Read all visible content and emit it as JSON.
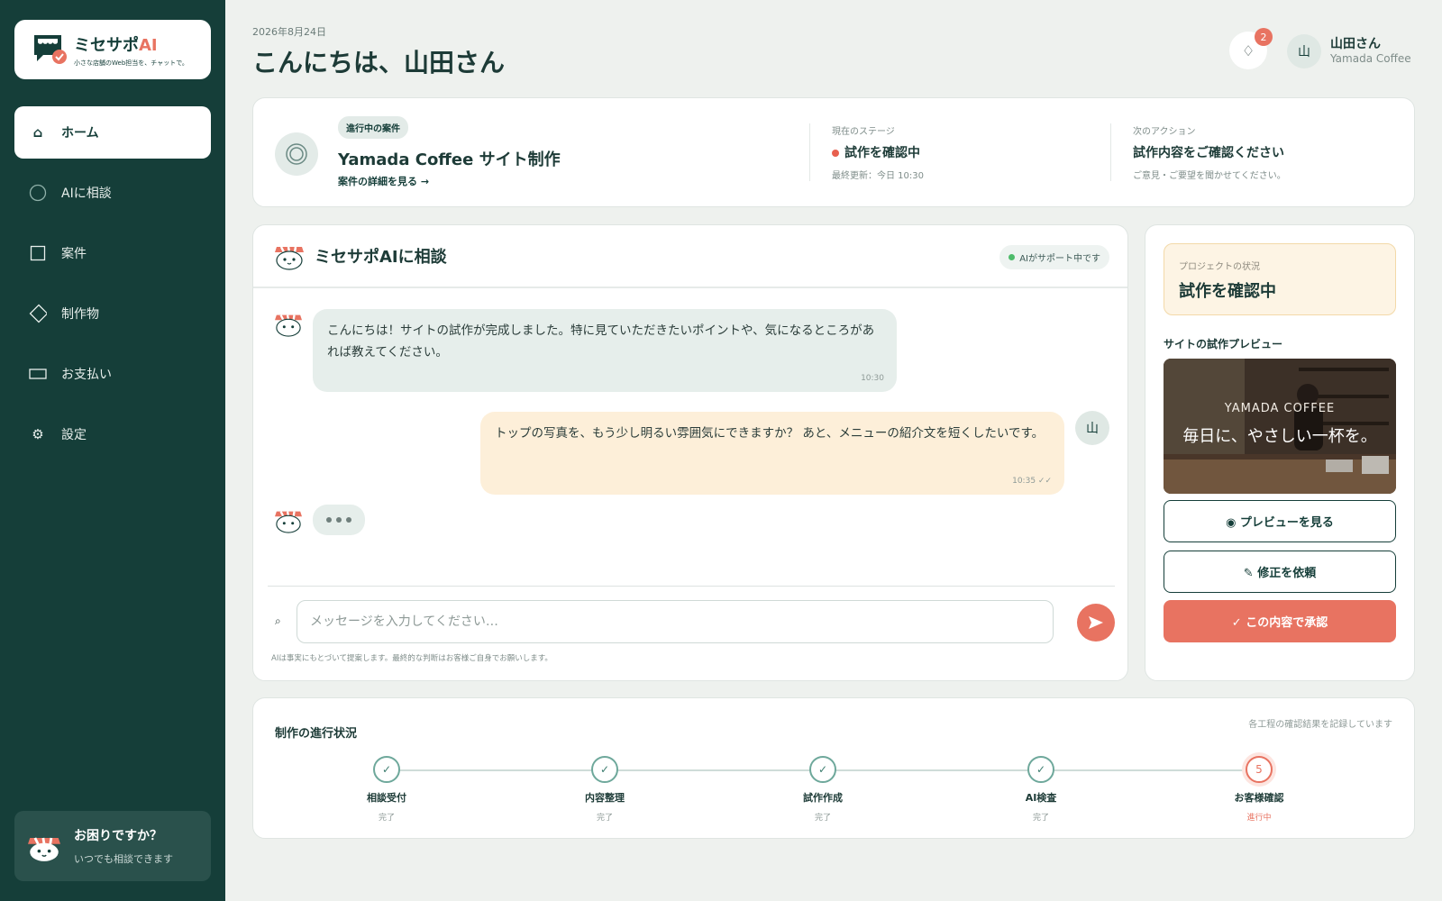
{
  "app": {
    "name_part1": "ミセサポ",
    "name_part2": "AI",
    "tagline": "小さな店舗のWeb担当を、チャットで。"
  },
  "sidebar": {
    "items": [
      {
        "label": "ホーム",
        "icon": "home-icon"
      },
      {
        "label": "AIに相談",
        "icon": "chat-circle-icon"
      },
      {
        "label": "案件",
        "icon": "square-icon"
      },
      {
        "label": "制作物",
        "icon": "diamond-icon"
      },
      {
        "label": "お支払い",
        "icon": "card-icon"
      },
      {
        "label": "設定",
        "icon": "gear-icon"
      }
    ],
    "help": {
      "title": "お困りですか？",
      "subtitle": "いつでも相談できます"
    }
  },
  "header": {
    "date": "2026年8月24日",
    "greeting": "こんにちは、山田さん",
    "notifications": "2",
    "user": {
      "initial": "山",
      "name": "山田さん",
      "shop": "Yamada Coffee"
    }
  },
  "project": {
    "badge": "進行中の案件",
    "title": "Yamada Coffee サイト制作",
    "link": "案件の詳細を見る →",
    "stage_label": "現在のステージ",
    "stage_value": "試作を確認中",
    "stage_updated": "最終更新：今日 10:30",
    "action_label": "次のアクション",
    "action_value": "試作内容をご確認ください",
    "action_sub": "ご意見・ご要望を聞かせてください。"
  },
  "chat": {
    "title": "ミセサポAIに相談",
    "status": "AIがサポート中です",
    "messages": [
      {
        "from": "ai",
        "text": "こんにちは！サイトの試作が完成しました。特に見ていただきたいポイントや、気になるところがあれば教えてください。",
        "time": "10:30"
      },
      {
        "from": "user",
        "text": "トップの写真を、もう少し明るい雰囲気にできますか？ あと、メニューの紹介文を短くしたいです。",
        "time": "10:35 ✓✓"
      }
    ],
    "user_initial": "山",
    "input_placeholder": "メッセージを入力してください…",
    "disclaimer": "AIは事実にもとづいて提案します。最終的な判断はお客様ご自身でお願いします。"
  },
  "side": {
    "status_label": "プロジェクトの状況",
    "status_value": "試作を確認中",
    "preview_label": "サイトの試作プレビュー",
    "preview_brand": "YAMADA COFFEE",
    "preview_tagline": "毎日に、やさしい一杯を。",
    "btn_preview": "◉ プレビューを見る",
    "btn_revise": "✎ 修正を依頼",
    "btn_approve": "✓ この内容で承認"
  },
  "progress": {
    "title": "制作の進行状況",
    "note": "各工程の確認結果を記録しています",
    "steps": [
      {
        "label": "相談受付",
        "status": "完了",
        "mark": "✓"
      },
      {
        "label": "内容整理",
        "status": "完了",
        "mark": "✓"
      },
      {
        "label": "試作作成",
        "status": "完了",
        "mark": "✓"
      },
      {
        "label": "AI検査",
        "status": "完了",
        "mark": "✓"
      },
      {
        "label": "お客様確認",
        "status": "進行中",
        "mark": "5"
      }
    ]
  },
  "colors": {
    "primary": "#153e39",
    "accent": "#e87361",
    "background": "#eef1ee"
  }
}
